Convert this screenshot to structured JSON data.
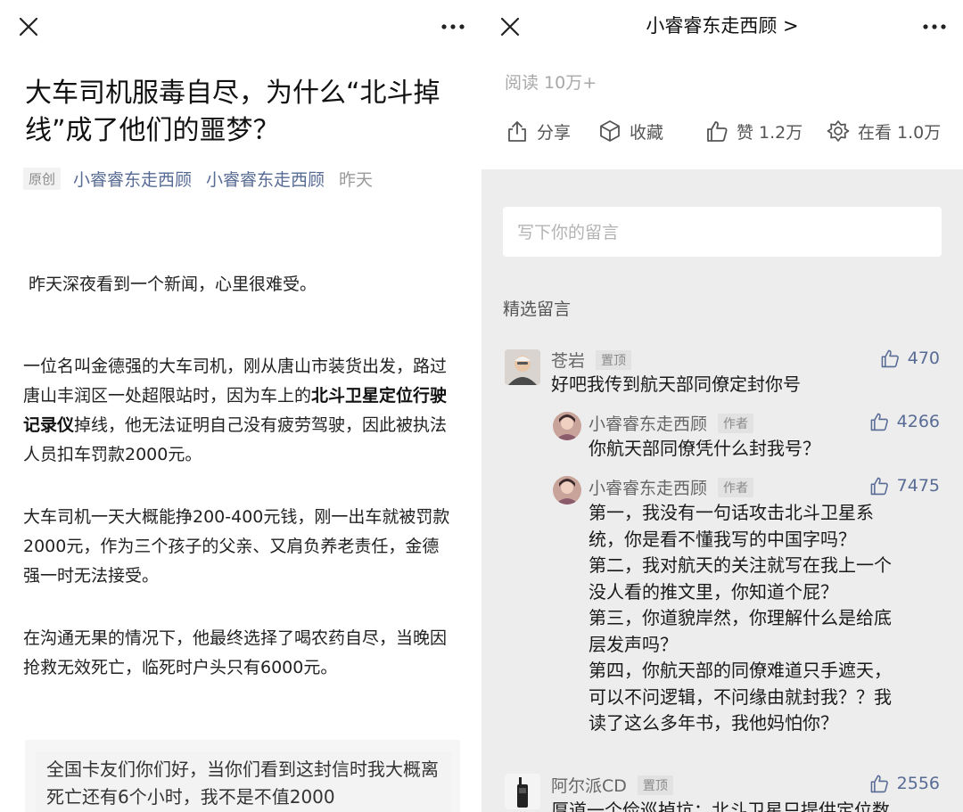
{
  "left": {
    "title": "大车司机服毒自尽，为什么“北斗掉线”成了他们的噩梦？",
    "meta": {
      "original_tag": "原创",
      "author": "小睿睿东走西顾",
      "account": "小睿睿东走西顾",
      "date": "昨天"
    },
    "paragraphs": [
      "昨天深夜看到一个新闻，心里很难受。",
      "大车司机一天大概能挣200-400元钱，刚一出车就被罚款2000元，作为三个孩子的父亲、又肩负养老责任，金德强一时无法接受。",
      "在沟通无果的情况下，他最终选择了喝农药自尽，当晚因抢救无效死亡，临死时户头只有6000元。"
    ],
    "para2": {
      "before": "一位名叫金德强的大车司机，刚从唐山市装货出发，路过唐山丰润区一处超限站时，因为车上的",
      "bold": "北斗卫星定位行驶记录仪",
      "after": "掉线，他无法证明自己没有疲劳驾驶，因此被执法人员扣车罚款2000元。"
    },
    "quote": "全国卡友们你们好，当你们看到这封信时我大概离死亡还有6个小时，我不是不值2000"
  },
  "right": {
    "account_title": "小睿睿东走西顾 >",
    "read_count": "阅读 10万+",
    "actions": {
      "share": "分享",
      "collect": "收藏",
      "like": "赞 1.2万",
      "watching": "在看 1.0万"
    },
    "comment_placeholder": "写下你的留言",
    "section_label": "精选留言",
    "comments": [
      {
        "name": "苍岩",
        "tag": "置顶",
        "likes": "470",
        "text": "好吧我传到航天部同僚定封你号"
      },
      {
        "name": "小睿睿东走西顾",
        "tag": "作者",
        "likes": "4266",
        "text": "你航天部同僚凭什么封我号？"
      },
      {
        "name": "小睿睿东走西顾",
        "tag": "作者",
        "likes": "7475",
        "lines": [
          "第一，我没有一句话攻击北斗卫星系",
          "统，你是看不懂我写的中国字吗？",
          "第二，我对航天的关注就写在我上一个",
          "没人看的推文里，你知道个屁？",
          "第三，你道貌岸然，你理解什么是给底",
          "层发声吗？",
          "第四，你航天部的同僚难道只手遮天，",
          "可以不问逻辑，不问缘由就封我？？我",
          "读了这么多年书，我他妈怕你？"
        ]
      },
      {
        "name": "阿尔派CD",
        "tag": "置顶",
        "likes": "2556",
        "text": "厚道一个俭巡掉坑：北斗卫星只提供定位数"
      }
    ]
  }
}
